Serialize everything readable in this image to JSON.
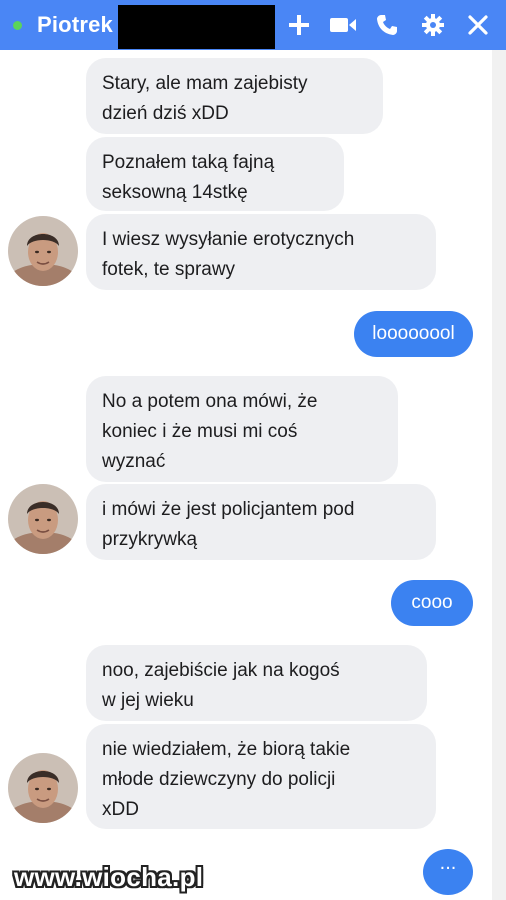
{
  "header": {
    "contact_name": "Piotrek",
    "online": true,
    "icons": [
      "plus-icon",
      "video-camera-icon",
      "phone-icon",
      "gear-icon",
      "close-icon"
    ],
    "accent": "#4a86f5"
  },
  "messages": [
    {
      "from": "them",
      "text": "Stary, ale mam zajebisty\ndzień dziś xDD"
    },
    {
      "from": "them",
      "text": "Poznałem taką fajną\nseksowną 14stkę"
    },
    {
      "from": "them",
      "text": "I wiesz wysyłanie erotycznych\nfotek, te sprawy"
    },
    {
      "from": "me",
      "text": "loooooool"
    },
    {
      "from": "them",
      "text": "No a potem ona mówi, że\nkoniec i że musi mi coś\nwyznać"
    },
    {
      "from": "them",
      "text": "i mówi że jest policjantem pod\nprzykrywką"
    },
    {
      "from": "me",
      "text": "cooo"
    },
    {
      "from": "them",
      "text": "noo, zajebiście jak na kogoś\nw jej wieku"
    },
    {
      "from": "them",
      "text": "nie wiedziałem, że biorą takie\nmłode dziewczyny do policji\nxDD"
    }
  ],
  "typing_indicator": "...",
  "watermark": "www.wiocha.pl",
  "colors": {
    "my_bubble": "#3b82f1",
    "their_bubble": "#eeeff2"
  }
}
